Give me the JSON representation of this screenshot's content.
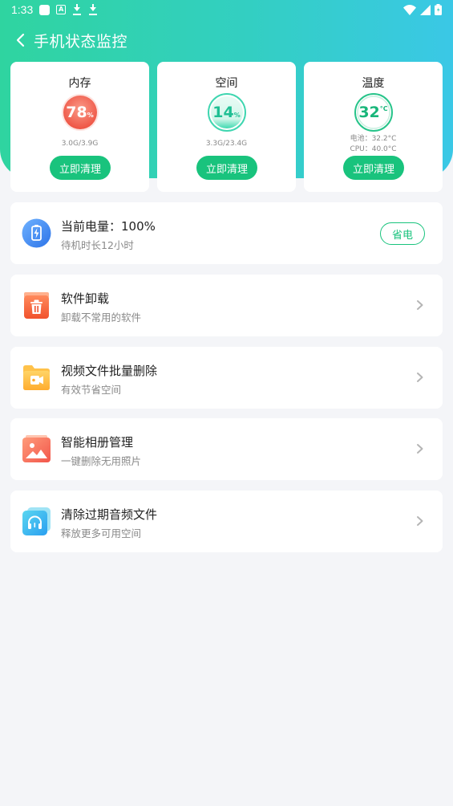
{
  "status_bar": {
    "time": "1:33"
  },
  "header": {
    "title": "手机状态监控"
  },
  "stats": [
    {
      "label": "内存",
      "value": "78",
      "unit": "%",
      "sub": "3.0G/3.9G",
      "button": "立即清理",
      "level": 0.78
    },
    {
      "label": "空间",
      "value": "14",
      "unit": "%",
      "sub": "3.3G/23.4G",
      "button": "立即清理",
      "level": 0.14
    },
    {
      "label": "温度",
      "value": "32",
      "unit": "°C",
      "sub_line1": "电池：32.2°C",
      "sub_line2": "CPU：40.0°C",
      "button": "立即清理"
    }
  ],
  "battery": {
    "title": "当前电量：100%",
    "sub": "待机时长12小时",
    "button": "省电"
  },
  "items": [
    {
      "title": "软件卸载",
      "sub": "卸载不常用的软件",
      "icon": "trash-icon"
    },
    {
      "title": "视频文件批量删除",
      "sub": "有效节省空间",
      "icon": "video-folder-icon"
    },
    {
      "title": "智能相册管理",
      "sub": "一键删除无用照片",
      "icon": "photo-album-icon"
    },
    {
      "title": "清除过期音频文件",
      "sub": "释放更多可用空间",
      "icon": "headphones-icon"
    }
  ],
  "colors": {
    "accent": "#19c37d",
    "memory": "#ef5a4c",
    "storage": "#2bd0a8",
    "temp": "#19b67a"
  }
}
